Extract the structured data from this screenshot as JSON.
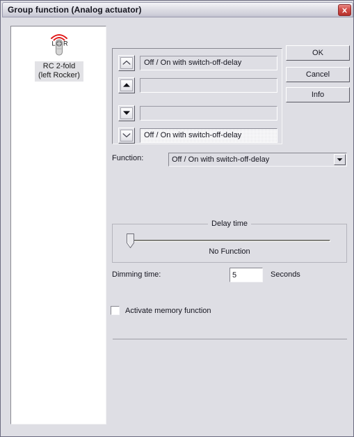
{
  "window": {
    "title": "Group function (Analog actuator)",
    "close_icon": "close-icon"
  },
  "device_panel": {
    "item": {
      "icon": "remote-control-icon",
      "left_key": "L",
      "right_key": "R",
      "label": "RC 2-fold\n(left Rocker)"
    }
  },
  "function_list": {
    "rows": [
      {
        "arrow": "chevron-up-icon",
        "arrow_state": "disabled",
        "text": "Off / On with switch-off-delay",
        "focused": false
      },
      {
        "arrow": "chevron-up-icon",
        "arrow_state": "enabled",
        "text": "",
        "focused": false
      },
      {
        "arrow": "chevron-down-icon",
        "arrow_state": "enabled",
        "text": "",
        "focused": false
      },
      {
        "arrow": "chevron-down-icon",
        "arrow_state": "disabled",
        "text": "Off / On with switch-off-delay",
        "focused": true
      }
    ]
  },
  "buttons": {
    "ok": "OK",
    "cancel": "Cancel",
    "info": "Info"
  },
  "function_row": {
    "label": "Function:",
    "selected": "Off / On with switch-off-delay",
    "dropdown_icon": "chevron-down-icon"
  },
  "delay_group": {
    "title": "Delay time",
    "status": "No Function",
    "slider_value": 0,
    "slider_min": 0,
    "slider_max": 100
  },
  "dimming": {
    "label": "Dimming time:",
    "value": "5",
    "placeholder": "",
    "unit": "Seconds"
  },
  "memory": {
    "label": "Activate memory function",
    "checked": false
  },
  "colors": {
    "face": "#dedee4",
    "text": "#15151f",
    "close_red": "#b62f2b",
    "radio_red": "#e01b1b",
    "slider_track": "#93938e"
  }
}
